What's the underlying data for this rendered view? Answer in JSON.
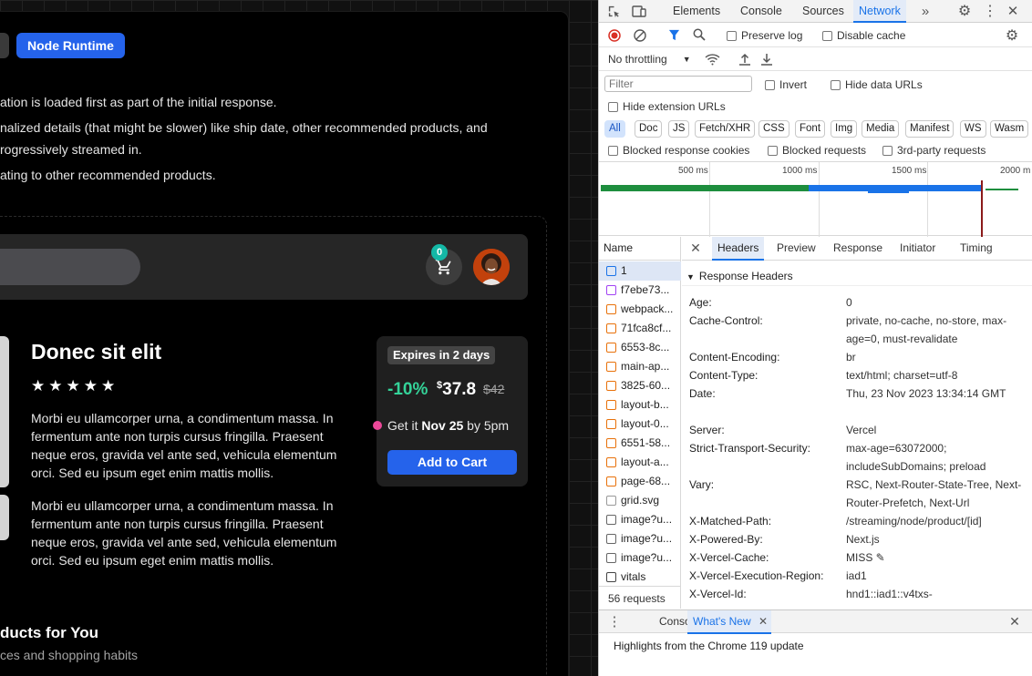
{
  "page": {
    "tabs": [
      {
        "label": ""
      },
      {
        "label": "Node Runtime"
      }
    ],
    "bullets": [
      "ation is loaded first as part of the initial response.",
      "nalized details (that might be slower) like ship date, other recommended products, and",
      "rogressively streamed in.",
      "ating to other recommended products."
    ],
    "cart_count": "0",
    "product": {
      "title": "Donec sit elit",
      "stars": "★★★★★",
      "desc1": "Morbi eu ullamcorper urna, a condimentum massa. In fermentum ante non turpis cursus fringilla. Praesent neque eros, gravida vel ante sed, vehicula elementum orci. Sed eu ipsum eget enim mattis mollis.",
      "desc2": "Morbi eu ullamcorper urna, a condimentum massa. In fermentum ante non turpis cursus fringilla. Praesent neque eros, gravida vel ante sed, vehicula elementum orci. Sed eu ipsum eget enim mattis mollis."
    },
    "price_card": {
      "expires": "Expires in 2 days",
      "discount": "-10%",
      "currency": "$",
      "price": "37.8",
      "old_price": "$42",
      "ship_prefix": "Get it ",
      "ship_date": "Nov 25",
      "ship_suffix": " by 5pm",
      "add_to_cart": "Add to Cart"
    },
    "recommended": {
      "title": "ducts for You",
      "subtitle": "ces and shopping habits"
    }
  },
  "devtools": {
    "tabs": [
      "Elements",
      "Console",
      "Sources",
      "Network"
    ],
    "active_tab": "Network",
    "preserve_log": "Preserve log",
    "disable_cache": "Disable cache",
    "throttling": "No throttling",
    "filter_placeholder": "Filter",
    "invert": "Invert",
    "hide_data_urls": "Hide data URLs",
    "hide_extension_urls": "Hide extension URLs",
    "types": [
      "All",
      "Doc",
      "JS",
      "Fetch/XHR",
      "CSS",
      "Font",
      "Img",
      "Media",
      "Manifest",
      "WS",
      "Wasm"
    ],
    "blocked_cookies": "Blocked response cookies",
    "blocked_requests": "Blocked requests",
    "third_party": "3rd-party requests",
    "timeline_ticks": [
      "500 ms",
      "1000 ms",
      "1500 ms",
      "2000 m"
    ],
    "name_header": "Name",
    "requests": [
      {
        "name": "1",
        "kind": "doc"
      },
      {
        "name": "f7ebe73...",
        "kind": "css"
      },
      {
        "name": "webpack...",
        "kind": "js"
      },
      {
        "name": "71fca8cf...",
        "kind": "js"
      },
      {
        "name": "6553-8c...",
        "kind": "js"
      },
      {
        "name": "main-ap...",
        "kind": "js"
      },
      {
        "name": "3825-60...",
        "kind": "js"
      },
      {
        "name": "layout-b...",
        "kind": "js"
      },
      {
        "name": "layout-0...",
        "kind": "js"
      },
      {
        "name": "6551-58...",
        "kind": "js"
      },
      {
        "name": "layout-a...",
        "kind": "js"
      },
      {
        "name": "page-68...",
        "kind": "js"
      },
      {
        "name": "grid.svg",
        "kind": "svg"
      },
      {
        "name": "image?u...",
        "kind": "img"
      },
      {
        "name": "image?u...",
        "kind": "img"
      },
      {
        "name": "image?u...",
        "kind": "img"
      },
      {
        "name": "vitals",
        "kind": "other"
      }
    ],
    "request_count": "56 requests",
    "detail_tabs": [
      "Headers",
      "Preview",
      "Response",
      "Initiator",
      "Timing"
    ],
    "section": "Response Headers",
    "headers": [
      {
        "name": "Age:",
        "value": "0"
      },
      {
        "name": "Cache-Control:",
        "value": "private, no-cache, no-store, max-age=0, must-revalidate"
      },
      {
        "name": "Content-Encoding:",
        "value": "br"
      },
      {
        "name": "Content-Type:",
        "value": "text/html; charset=utf-8"
      },
      {
        "name": "Date:",
        "value": "Thu, 23 Nov 2023 13:34:14 GMT"
      },
      {
        "name": "Server:",
        "value": "Vercel"
      },
      {
        "name": "Strict-Transport-Security:",
        "value": "max-age=63072000; includeSubDomains; preload"
      },
      {
        "name": "Vary:",
        "value": "RSC, Next-Router-State-Tree, Next-Router-Prefetch, Next-Url"
      },
      {
        "name": "X-Matched-Path:",
        "value": "/streaming/node/product/[id]"
      },
      {
        "name": "X-Powered-By:",
        "value": "Next.js"
      },
      {
        "name": "X-Vercel-Cache:",
        "value": "MISS"
      },
      {
        "name": "X-Vercel-Execution-Region:",
        "value": "iad1"
      },
      {
        "name": "X-Vercel-Id:",
        "value": "hnd1::iad1::v4txs-"
      }
    ],
    "drawer_tabs": [
      "Console",
      "What's New"
    ],
    "drawer_text": "Highlights from the Chrome 119 update"
  }
}
